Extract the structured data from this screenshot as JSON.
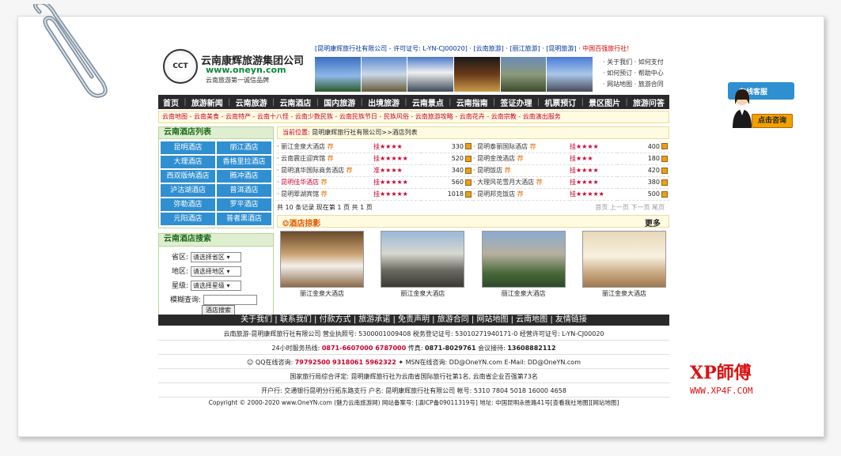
{
  "header": {
    "logo_mark": "CCT",
    "logo_name": "云南康辉旅游集团公司",
    "logo_url": "www.oneyn.com",
    "logo_slogan": "云南旅游第一诚信品牌",
    "toplinks": {
      "company": "[昆明康辉旅行社有限公司 - 许可证号: L-YN-CJ00020]",
      "yunnan": "[云南旅游]",
      "lijiang": "[丽江旅游]",
      "kunming": "[昆明旅游]",
      "hundred": "中国百强旅行社!"
    },
    "quick": [
      "· 关于我们 · 如何支付",
      "· 如何预订 · 帮助中心",
      "· 网站地图 · 旅游合同"
    ]
  },
  "nav": [
    "首页",
    "旅游新闻",
    "云南旅游",
    "云南酒店",
    "国内旅游",
    "出境旅游",
    "云南景点",
    "云南指南",
    "签证办理",
    "机票预订",
    "景区图片",
    "旅游问答"
  ],
  "subnav": "云南地图 - 云南美食 - 云南特产 - 云南十八怪 - 云南少数民族 - 云南民族节日 - 民族风俗 - 云南旅游攻略 - 云南花卉 - 云南宗教 - 云南演出服务",
  "left": {
    "hotel_list_title": "云南酒店列表",
    "hotels": [
      "昆明酒店",
      "丽江酒店",
      "大理酒店",
      "香格里拉酒店",
      "西双版纳酒店",
      "腾冲酒店",
      "泸沽湖酒店",
      "普洱酒店",
      "弥勒酒店",
      "罗平酒店",
      "元阳酒店",
      "普者黑酒店"
    ],
    "search_title": "云南酒店搜索",
    "province_label": "省区:",
    "province_value": "请选择省区",
    "area_label": "地区:",
    "area_value": "请选择地区",
    "star_label": "星级:",
    "star_value": "请选择星级",
    "fuzzy_label": "模糊查询:",
    "search_button": "酒店搜索"
  },
  "right": {
    "crumb_label": "当前位置:",
    "crumb_path": "昆明康辉旅行社有限公司>>酒店列表",
    "tag": "荐",
    "rows": [
      [
        {
          "name": "丽江金泉大酒店",
          "red": false,
          "star": "挂★★★★",
          "price": "330"
        },
        {
          "name": "昆明泰丽国际酒店",
          "red": false,
          "star": "挂★★★★",
          "price": "400"
        }
      ],
      [
        {
          "name": "云南震庄迎宾馆",
          "red": false,
          "star": "挂★★★★★",
          "price": "520"
        },
        {
          "name": "昆明金茂酒店",
          "red": false,
          "star": "挂★★★",
          "price": "180"
        }
      ],
      [
        {
          "name": "昆明滇华国际商务酒店",
          "red": false,
          "star": "准★★★★",
          "price": "340"
        },
        {
          "name": "昆明饭店",
          "red": false,
          "star": "挂★★★★",
          "price": "420"
        }
      ],
      [
        {
          "name": "昆明佳华酒店",
          "red": true,
          "star": "挂★★★★★",
          "price": "560"
        },
        {
          "name": "大理风花雪月大酒店",
          "red": false,
          "star": "挂★★★★",
          "price": "380"
        }
      ],
      [
        {
          "name": "昆明翠湖宾馆",
          "red": false,
          "star": "挂★★★★★",
          "price": "1018"
        },
        {
          "name": "昆明邦克饭店",
          "red": false,
          "star": "挂★★★★★",
          "price": "500"
        }
      ]
    ],
    "pager_left": "共 10 条记录  现在第 1 页 共 1 页",
    "pager_right": "首页  上一页  下一页  尾页",
    "photo_title": "❂酒店掠影",
    "more": "更多",
    "photos": [
      "丽江金泉大酒店",
      "丽江金泉大酒店",
      "丽江金泉大酒店",
      "丽江金泉大酒店"
    ]
  },
  "footer": {
    "nav": "关于我们 | 联系我们 | 付款方式 | 旅游承诺 | 免责声明 | 旅游合同 | 网站地图 | 云南地图 | 友情链接",
    "line1": "云南旅游-昆明康辉旅行社有限公司  营业执照号: 5300001009408   税务登记证号: 53010271940171-0   经营许可证号: L-YN-CJ00020",
    "hotline_label": "24小时服务热线:",
    "hotline": "0871-6607000  6787000",
    "fax_label": "传真:",
    "fax": "0871-8029761",
    "meeting_label": "会议接待:",
    "meeting": "13608882112",
    "qq_label": "QQ在线咨询:",
    "qq": "79792500  9318061  5962322",
    "msn_label": "MSN在线咨询:",
    "msn": "DD@OneYN.com",
    "email_label": "E-Mail:",
    "email": "DD@OneYN.com",
    "line4": "国家旅行局综合评定: 昆明康辉旅行社为云南省国际旅行社第1名, 云南省企业百强第73名",
    "line5": "开户行: 交通银行昆明分行拓东路支行  户名: 昆明康辉旅行社有限公司  帐号: 5310 7804 5018 16000 4658",
    "copyright": "Copyright © 2000-2020  www.OneYN.com (魅力云南旅游网)  网站备案号: [滇ICP备09011319号]  地址: 中国昆明永胜路41号[查看我社地图][网站地图]"
  },
  "service": {
    "title": "在线客服",
    "button": "点击咨询"
  },
  "watermark": {
    "title": "XP師傅",
    "url": "WWW.XP4F.COM"
  },
  "colors": {
    "nav_bg": "#2a2a2a",
    "accent_red": "#c8002e",
    "hotel_button": "#2f8fd0",
    "green_title": "#1a6a1a"
  }
}
